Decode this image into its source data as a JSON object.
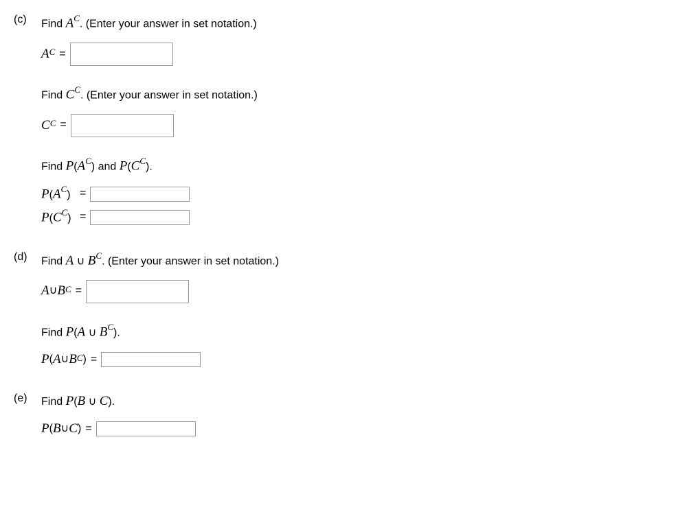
{
  "parts": {
    "c": {
      "label": "(c)",
      "block1": {
        "prompt_pre": "Find ",
        "prompt_var": "A",
        "prompt_sup": "C",
        "prompt_post": ". (Enter your answer in set notation.)",
        "lhs_var": "A",
        "lhs_sup": "C",
        "eq": "="
      },
      "block2": {
        "prompt_pre": "Find ",
        "prompt_var": "C",
        "prompt_sup": "C",
        "prompt_post": ". (Enter your answer in set notation.)",
        "lhs_var": "C",
        "lhs_sup": "C",
        "eq": "="
      },
      "block3": {
        "prompt_pre": "Find ",
        "p_var1": "P",
        "p_open1": "(",
        "p_a": "A",
        "p_sup_a": "C",
        "p_close1": ")",
        "and": " and ",
        "p_var2": "P",
        "p_open2": "(",
        "p_c": "C",
        "p_sup_c": "C",
        "p_close2": ").",
        "row1": {
          "p": "P",
          "open": "(",
          "v": "A",
          "sup": "C",
          "close": ")",
          "eq": "="
        },
        "row2": {
          "p": "P",
          "open": "(",
          "v": "C",
          "sup": "C",
          "close": ")",
          "eq": "="
        }
      }
    },
    "d": {
      "label": "(d)",
      "block1": {
        "prompt_pre": "Find ",
        "v1": "A",
        "union": " ∪ ",
        "v2": "B",
        "sup": "C",
        "prompt_post": ". (Enter your answer in set notation.)",
        "lhs_v1": "A",
        "lhs_union": " ∪ ",
        "lhs_v2": "B",
        "lhs_sup": "C",
        "eq": "="
      },
      "block2": {
        "prompt_pre": "Find ",
        "p": "P",
        "open": "(",
        "v1": "A",
        "union": " ∪ ",
        "v2": "B",
        "sup": "C",
        "close": ").",
        "row": {
          "p": "P",
          "open": "(",
          "v1": "A",
          "union": " ∪ ",
          "v2": "B",
          "sup": "C",
          "close": ")",
          "eq": "="
        }
      }
    },
    "e": {
      "label": "(e)",
      "block1": {
        "prompt_pre": "Find ",
        "p": "P",
        "open": "(",
        "v1": "B",
        "union": " ∪ ",
        "v2": "C",
        "close": ").",
        "row": {
          "p": "P",
          "open": "(",
          "v1": "B",
          "union": " ∪ ",
          "v2": "C",
          "close": ")",
          "eq": "="
        }
      }
    }
  }
}
